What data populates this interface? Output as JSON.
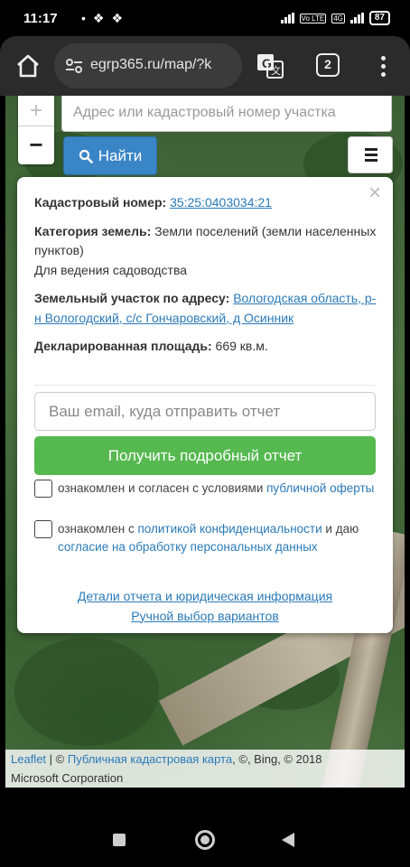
{
  "status_bar": {
    "time": "11:17",
    "battery": "87",
    "lte_tag": "Vo LTE",
    "net_tag": "4G"
  },
  "browser": {
    "url": "egrp365.ru/map/?k",
    "tab_count": "2"
  },
  "map": {
    "zoom_in": "+",
    "zoom_out": "−",
    "search_placeholder": "Адрес или кадастровый номер участка",
    "find_label": "Найти"
  },
  "popup": {
    "close": "×",
    "cadastral_label": "Кадастровый номер:",
    "cadastral_number": "35:25:0403034:21",
    "category_label": "Категория земель:",
    "category_value": "Земли поселений (земли населенных пунктов)",
    "usage": "Для ведения садоводства",
    "address_label": "Земельный участок по адресу:",
    "address_value": "Вологодская область, р-н Вологодский, с/с Гончаровский, д Осинник",
    "area_label": "Декларированная площадь:",
    "area_value": "669 кв.м.",
    "email_placeholder": "Ваш email, куда отправить отчет",
    "report_button": "Получить подробный отчет",
    "check1_text": "ознакомлен и согласен с условиями",
    "check1_link": "публичной оферты",
    "check2_text_a": "ознакомлен с",
    "check2_link_a": "политикой конфиденциальности",
    "check2_text_b": "и даю",
    "check2_link_b": "согласие на обработку персональных данных",
    "details_link": "Детали отчета и юридическая информация",
    "manual_link": "Ручной выбор вариантов"
  },
  "attribution": {
    "leaflet": "Leaflet",
    "sep": " | © ",
    "cadastral_map": "Публичная кадастровая карта",
    "rest": ", ©, Bing, © 2018",
    "line2": "Microsoft Corporation"
  },
  "colors": {
    "link": "#2a7ab8",
    "find_button": "#3a85c6",
    "report_button": "#55b94f"
  }
}
